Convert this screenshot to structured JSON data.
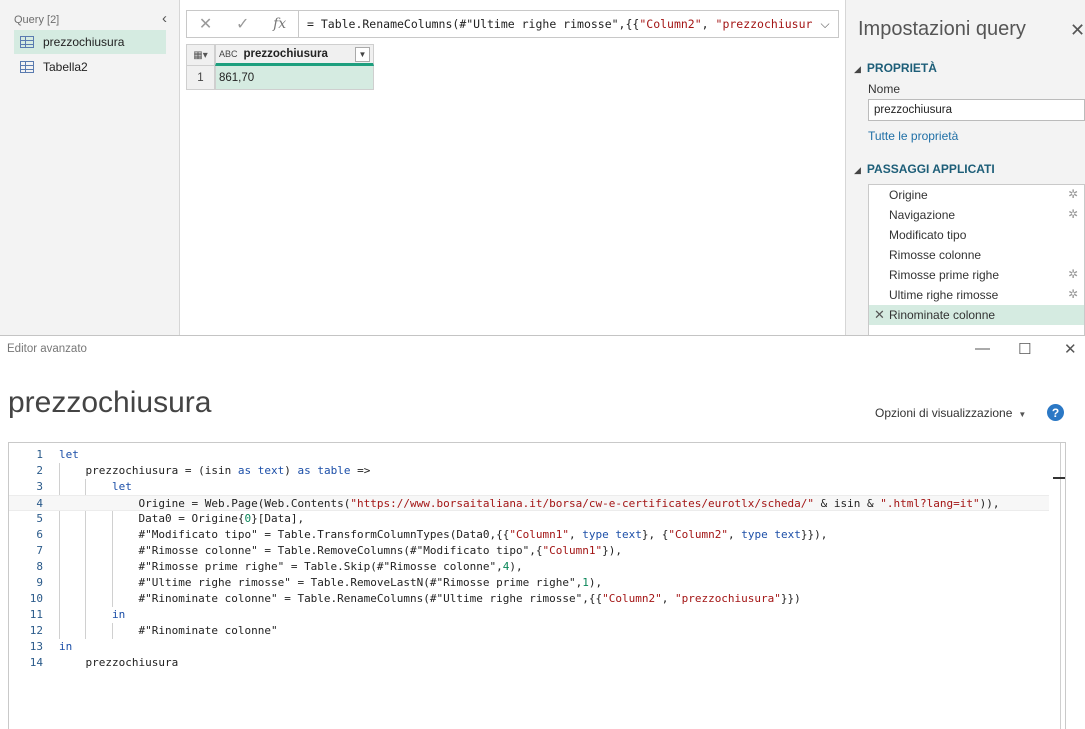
{
  "queries_pane": {
    "header": "Query [2]",
    "items": [
      {
        "label": "prezzochiusura",
        "selected": true
      },
      {
        "label": "Tabella2",
        "selected": false
      }
    ]
  },
  "formula_bar": {
    "cancel": "✕",
    "confirm": "✓",
    "fx": "fx",
    "text_prefix": "= Table.RenameColumns(#\"Ultime righe rimosse\",{{",
    "text_str1": "\"Column2\"",
    "text_mid": ", ",
    "text_str2": "\"prezzochiusura\"",
    "text_suffix": "}"
  },
  "grid": {
    "column_type": "ABC",
    "column_header": "prezzochiusura",
    "rows": [
      {
        "index": "1",
        "value": "861,70"
      }
    ]
  },
  "query_settings": {
    "title": "Impostazioni query",
    "properties_section": "PROPRIETÀ",
    "name_label": "Nome",
    "name_value": "prezzochiusura",
    "all_properties_link": "Tutte le proprietà",
    "steps_section": "PASSAGGI APPLICATI",
    "steps": [
      {
        "label": "Origine",
        "gear": true
      },
      {
        "label": "Navigazione",
        "gear": true
      },
      {
        "label": "Modificato tipo",
        "gear": false
      },
      {
        "label": "Rimosse colonne",
        "gear": false
      },
      {
        "label": "Rimosse prime righe",
        "gear": true
      },
      {
        "label": "Ultime righe rimosse",
        "gear": true
      },
      {
        "label": "Rinominate colonne",
        "gear": false,
        "selected": true
      }
    ]
  },
  "advanced_editor": {
    "window_title": "Editor avanzato",
    "query_name": "prezzochiusura",
    "display_options": "Opzioni di visualizzazione",
    "help": "?",
    "code_lines": [
      {
        "n": "1",
        "indent": 0,
        "tokens": [
          [
            "kw",
            "let"
          ]
        ]
      },
      {
        "n": "2",
        "indent": 1,
        "tokens": [
          [
            "t",
            "prezzochiusura = (isin "
          ],
          [
            "kw",
            "as"
          ],
          [
            "t",
            " "
          ],
          [
            "kw",
            "text"
          ],
          [
            "t",
            ") "
          ],
          [
            "kw",
            "as"
          ],
          [
            "t",
            " "
          ],
          [
            "kw",
            "table"
          ],
          [
            "t",
            " =>"
          ]
        ]
      },
      {
        "n": "3",
        "indent": 2,
        "tokens": [
          [
            "kw",
            "let"
          ]
        ]
      },
      {
        "n": "4",
        "indent": 3,
        "tokens": [
          [
            "t",
            "Origine = Web.Page(Web.Contents("
          ],
          [
            "st",
            "\"https://www.borsaitaliana.it/borsa/cw-e-certificates/eurotlx/scheda/\""
          ],
          [
            "t",
            " & isin & "
          ],
          [
            "st",
            "\".html?lang=it\""
          ],
          [
            "t",
            ")),"
          ]
        ]
      },
      {
        "n": "5",
        "indent": 3,
        "tokens": [
          [
            "t",
            "Data0 = Origine{"
          ],
          [
            "nu",
            "0"
          ],
          [
            "t",
            "}[Data],"
          ]
        ]
      },
      {
        "n": "6",
        "indent": 3,
        "tokens": [
          [
            "t",
            "#\"Modificato tipo\" = Table.TransformColumnTypes(Data0,{{"
          ],
          [
            "st",
            "\"Column1\""
          ],
          [
            "t",
            ", "
          ],
          [
            "kw",
            "type"
          ],
          [
            "t",
            " "
          ],
          [
            "kw",
            "text"
          ],
          [
            "t",
            "}, {"
          ],
          [
            "st",
            "\"Column2\""
          ],
          [
            "t",
            ", "
          ],
          [
            "kw",
            "type"
          ],
          [
            "t",
            " "
          ],
          [
            "kw",
            "text"
          ],
          [
            "t",
            "}}),"
          ]
        ]
      },
      {
        "n": "7",
        "indent": 3,
        "tokens": [
          [
            "t",
            "#\"Rimosse colonne\" = Table.RemoveColumns(#\"Modificato tipo\",{"
          ],
          [
            "st",
            "\"Column1\""
          ],
          [
            "t",
            "}),"
          ]
        ]
      },
      {
        "n": "8",
        "indent": 3,
        "tokens": [
          [
            "t",
            "#\"Rimosse prime righe\" = Table.Skip(#\"Rimosse colonne\","
          ],
          [
            "nu",
            "4"
          ],
          [
            "t",
            "),"
          ]
        ]
      },
      {
        "n": "9",
        "indent": 3,
        "tokens": [
          [
            "t",
            "#\"Ultime righe rimosse\" = Table.RemoveLastN(#\"Rimosse prime righe\","
          ],
          [
            "nu",
            "1"
          ],
          [
            "t",
            "),"
          ]
        ]
      },
      {
        "n": "10",
        "indent": 3,
        "tokens": [
          [
            "t",
            "#\"Rinominate colonne\" = Table.RenameColumns(#\"Ultime righe rimosse\",{{"
          ],
          [
            "st",
            "\"Column2\""
          ],
          [
            "t",
            ", "
          ],
          [
            "st",
            "\"prezzochiusura\""
          ],
          [
            "t",
            "}})"
          ]
        ]
      },
      {
        "n": "11",
        "indent": 2,
        "tokens": [
          [
            "kw",
            "in"
          ]
        ]
      },
      {
        "n": "12",
        "indent": 3,
        "tokens": [
          [
            "t",
            "#\"Rinominate colonne\""
          ]
        ]
      },
      {
        "n": "13",
        "indent": 0,
        "tokens": [
          [
            "kw",
            "in"
          ]
        ]
      },
      {
        "n": "14",
        "indent": 1,
        "tokens": [
          [
            "t",
            "prezzochiusura"
          ]
        ]
      }
    ]
  },
  "colors": {
    "selection": "#d5ebe1",
    "column_accent": "#1d9f7e",
    "keyword": "#1c4fa8",
    "string": "#a31515",
    "number": "#098658",
    "section_heading": "#1d5e78",
    "link": "#1f6fa6",
    "help_button": "#2b78c5"
  },
  "icons": {
    "query_item": "table-icon",
    "collapse": "chevron-left-icon",
    "close": "close-icon",
    "step_settings": "gear-icon",
    "step_delete": "delete-x-icon"
  }
}
